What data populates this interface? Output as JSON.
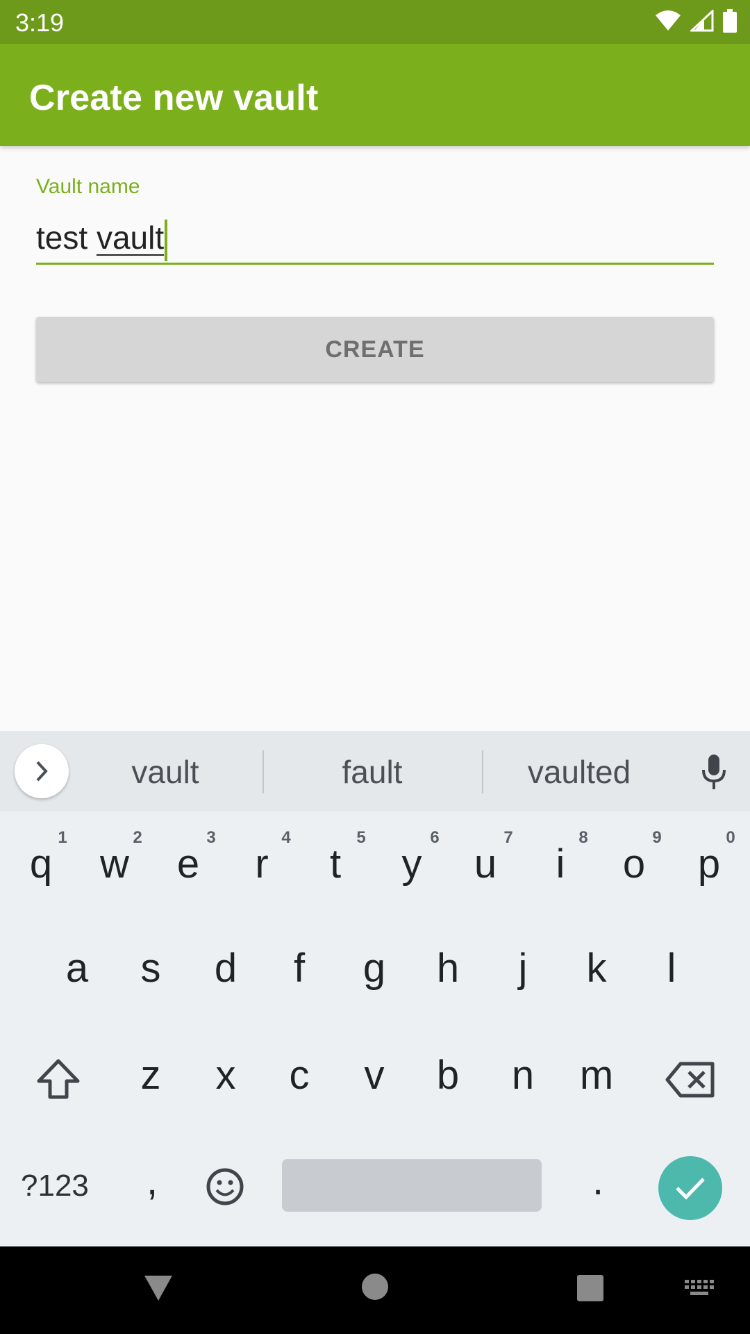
{
  "status_bar": {
    "time": "3:19",
    "icons": [
      "wifi-icon",
      "signal-icon",
      "battery-icon"
    ]
  },
  "app_bar": {
    "title": "Create new vault"
  },
  "form": {
    "label": "Vault name",
    "value_prefix": "test ",
    "value_composing": "vault",
    "create_label": "CREATE"
  },
  "keyboard": {
    "suggestions": [
      "vault",
      "fault",
      "vaulted"
    ],
    "row1": [
      "q",
      "w",
      "e",
      "r",
      "t",
      "y",
      "u",
      "i",
      "o",
      "p"
    ],
    "row1_hints": [
      "1",
      "2",
      "3",
      "4",
      "5",
      "6",
      "7",
      "8",
      "9",
      "0"
    ],
    "row2": [
      "a",
      "s",
      "d",
      "f",
      "g",
      "h",
      "j",
      "k",
      "l"
    ],
    "row3": [
      "z",
      "x",
      "c",
      "v",
      "b",
      "n",
      "m"
    ],
    "symbols_label": "?123",
    "comma": ",",
    "period": "."
  },
  "colors": {
    "accent": "#7baf1c",
    "status_bar": "#6e9a1b",
    "action": "#4db8ac"
  }
}
